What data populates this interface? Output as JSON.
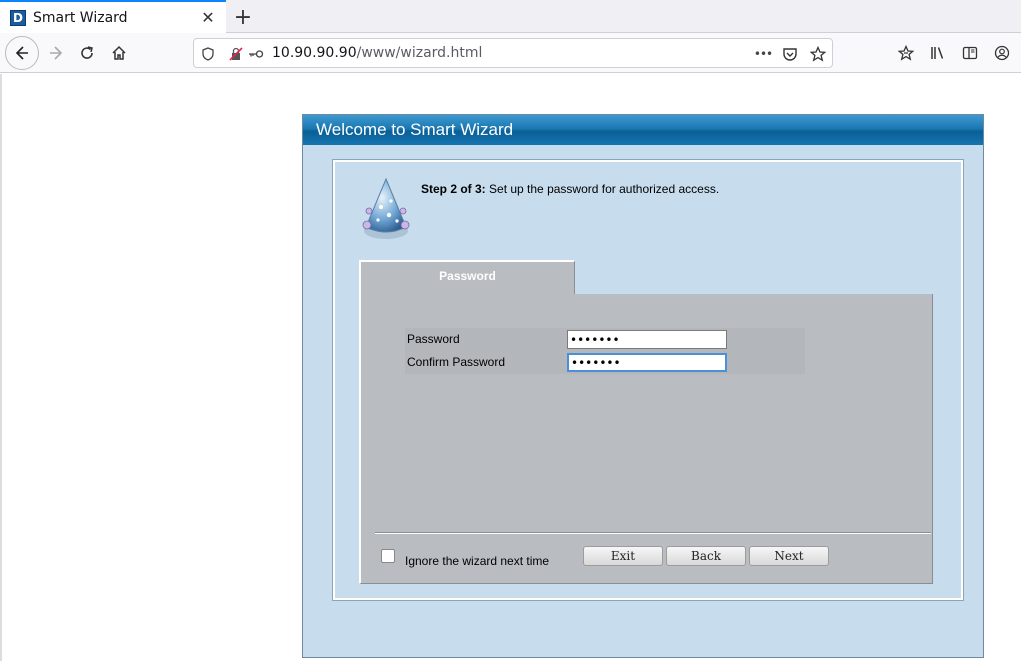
{
  "browser": {
    "tab_title": "Smart Wizard",
    "favicon_letter": "D",
    "close_glyph": "✕",
    "newtab_glyph": "+",
    "url_host": "10.90.90.90",
    "url_path": "/www/wizard.html",
    "more_glyph": "•••"
  },
  "wizard": {
    "title": "Welcome to Smart Wizard",
    "step_label": "Step 2 of 3:",
    "step_desc": " Set up the password for authorized access.",
    "tab_label": "Password",
    "password_label": "Password",
    "password_value": "•••••••",
    "confirm_label": "Confirm Password",
    "confirm_value": "•••••••",
    "ignore_label": "Ignore the wizard next time",
    "exit_label": "Exit",
    "back_label": "Back",
    "next_label": "Next"
  },
  "colors": {
    "accent": "#0a84ff",
    "header_blue": "#1a78b3",
    "frame_bg": "#c7dcec",
    "panel_gray": "#b9bcc1"
  }
}
